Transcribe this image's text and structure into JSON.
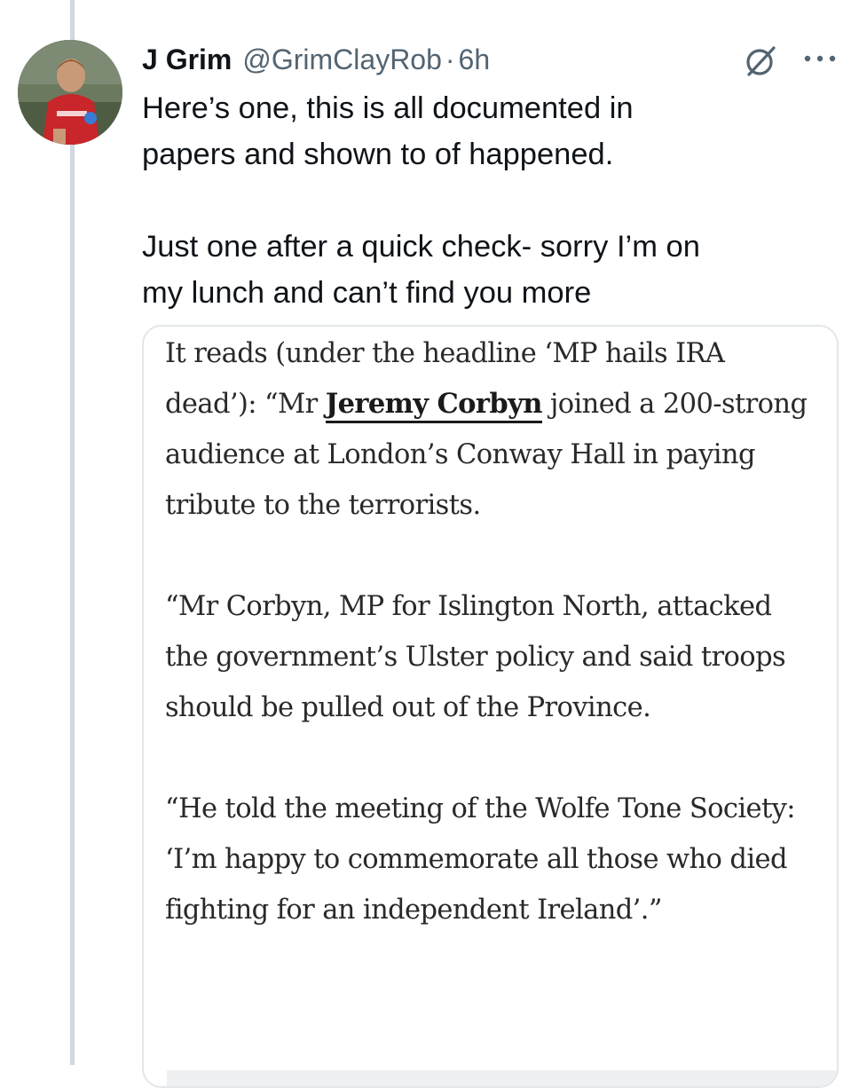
{
  "tweet": {
    "author_name": "J Grim",
    "handle": "@GrimClayRob",
    "separator": "·",
    "time": "6h",
    "text": "Here’s one, this is all documented in\npapers and shown to of happened.\n\nJust one after a quick check- sorry I’m on\nmy lunch and can’t find you more"
  },
  "icons": {
    "grok": "grok-icon",
    "more": "more-icon",
    "avatar": "avatar-photo"
  },
  "article": {
    "p1_before": "It reads (under the headline ‘MP hails IRA dead’): “Mr ",
    "p1_link": "Jeremy Corbyn",
    "p1_after": " joined a 200-strong audience at London’s Conway Hall in paying tribute to the terrorists.",
    "p2": "“Mr Corbyn, MP for Islington North, attacked the government’s Ulster policy and said troops should be pulled out of the Province.",
    "p3": "“He told the meeting of the Wolfe Tone Society: ‘I’m happy to commemorate all those who died fighting for an independent Ireland’.”"
  },
  "colors": {
    "text": "#0f1419",
    "secondary": "#536471",
    "thread_line": "#cfd9de",
    "card_border": "#e3e7ea"
  }
}
